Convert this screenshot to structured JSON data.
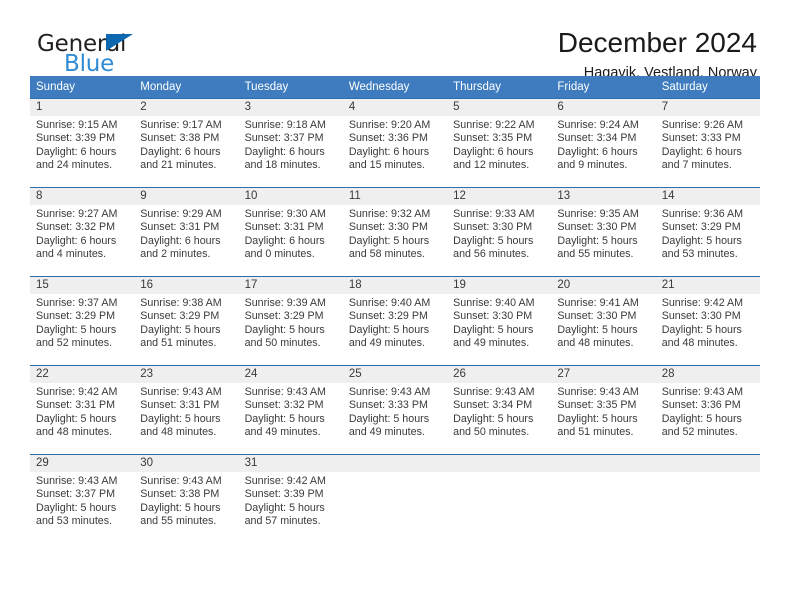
{
  "brand": {
    "name_part1": "General",
    "name_part2": "Blue",
    "triangle_color": "#0d68b1",
    "blue_color": "#2e8bd4"
  },
  "header": {
    "title": "December 2024",
    "subtitle": "Hagavik, Vestland, Norway"
  },
  "theme": {
    "header_blue": "#3e7cbf",
    "row_divider": "#2d6ca8",
    "daynum_band": "#efefef",
    "text": "#3a3a3a"
  },
  "weekdays": [
    "Sunday",
    "Monday",
    "Tuesday",
    "Wednesday",
    "Thursday",
    "Friday",
    "Saturday"
  ],
  "weeks": [
    [
      {
        "day": "1",
        "sunrise": "Sunrise: 9:15 AM",
        "sunset": "Sunset: 3:39 PM",
        "daylight1": "Daylight: 6 hours",
        "daylight2": "and 24 minutes."
      },
      {
        "day": "2",
        "sunrise": "Sunrise: 9:17 AM",
        "sunset": "Sunset: 3:38 PM",
        "daylight1": "Daylight: 6 hours",
        "daylight2": "and 21 minutes."
      },
      {
        "day": "3",
        "sunrise": "Sunrise: 9:18 AM",
        "sunset": "Sunset: 3:37 PM",
        "daylight1": "Daylight: 6 hours",
        "daylight2": "and 18 minutes."
      },
      {
        "day": "4",
        "sunrise": "Sunrise: 9:20 AM",
        "sunset": "Sunset: 3:36 PM",
        "daylight1": "Daylight: 6 hours",
        "daylight2": "and 15 minutes."
      },
      {
        "day": "5",
        "sunrise": "Sunrise: 9:22 AM",
        "sunset": "Sunset: 3:35 PM",
        "daylight1": "Daylight: 6 hours",
        "daylight2": "and 12 minutes."
      },
      {
        "day": "6",
        "sunrise": "Sunrise: 9:24 AM",
        "sunset": "Sunset: 3:34 PM",
        "daylight1": "Daylight: 6 hours",
        "daylight2": "and 9 minutes."
      },
      {
        "day": "7",
        "sunrise": "Sunrise: 9:26 AM",
        "sunset": "Sunset: 3:33 PM",
        "daylight1": "Daylight: 6 hours",
        "daylight2": "and 7 minutes."
      }
    ],
    [
      {
        "day": "8",
        "sunrise": "Sunrise: 9:27 AM",
        "sunset": "Sunset: 3:32 PM",
        "daylight1": "Daylight: 6 hours",
        "daylight2": "and 4 minutes."
      },
      {
        "day": "9",
        "sunrise": "Sunrise: 9:29 AM",
        "sunset": "Sunset: 3:31 PM",
        "daylight1": "Daylight: 6 hours",
        "daylight2": "and 2 minutes."
      },
      {
        "day": "10",
        "sunrise": "Sunrise: 9:30 AM",
        "sunset": "Sunset: 3:31 PM",
        "daylight1": "Daylight: 6 hours",
        "daylight2": "and 0 minutes."
      },
      {
        "day": "11",
        "sunrise": "Sunrise: 9:32 AM",
        "sunset": "Sunset: 3:30 PM",
        "daylight1": "Daylight: 5 hours",
        "daylight2": "and 58 minutes."
      },
      {
        "day": "12",
        "sunrise": "Sunrise: 9:33 AM",
        "sunset": "Sunset: 3:30 PM",
        "daylight1": "Daylight: 5 hours",
        "daylight2": "and 56 minutes."
      },
      {
        "day": "13",
        "sunrise": "Sunrise: 9:35 AM",
        "sunset": "Sunset: 3:30 PM",
        "daylight1": "Daylight: 5 hours",
        "daylight2": "and 55 minutes."
      },
      {
        "day": "14",
        "sunrise": "Sunrise: 9:36 AM",
        "sunset": "Sunset: 3:29 PM",
        "daylight1": "Daylight: 5 hours",
        "daylight2": "and 53 minutes."
      }
    ],
    [
      {
        "day": "15",
        "sunrise": "Sunrise: 9:37 AM",
        "sunset": "Sunset: 3:29 PM",
        "daylight1": "Daylight: 5 hours",
        "daylight2": "and 52 minutes."
      },
      {
        "day": "16",
        "sunrise": "Sunrise: 9:38 AM",
        "sunset": "Sunset: 3:29 PM",
        "daylight1": "Daylight: 5 hours",
        "daylight2": "and 51 minutes."
      },
      {
        "day": "17",
        "sunrise": "Sunrise: 9:39 AM",
        "sunset": "Sunset: 3:29 PM",
        "daylight1": "Daylight: 5 hours",
        "daylight2": "and 50 minutes."
      },
      {
        "day": "18",
        "sunrise": "Sunrise: 9:40 AM",
        "sunset": "Sunset: 3:29 PM",
        "daylight1": "Daylight: 5 hours",
        "daylight2": "and 49 minutes."
      },
      {
        "day": "19",
        "sunrise": "Sunrise: 9:40 AM",
        "sunset": "Sunset: 3:30 PM",
        "daylight1": "Daylight: 5 hours",
        "daylight2": "and 49 minutes."
      },
      {
        "day": "20",
        "sunrise": "Sunrise: 9:41 AM",
        "sunset": "Sunset: 3:30 PM",
        "daylight1": "Daylight: 5 hours",
        "daylight2": "and 48 minutes."
      },
      {
        "day": "21",
        "sunrise": "Sunrise: 9:42 AM",
        "sunset": "Sunset: 3:30 PM",
        "daylight1": "Daylight: 5 hours",
        "daylight2": "and 48 minutes."
      }
    ],
    [
      {
        "day": "22",
        "sunrise": "Sunrise: 9:42 AM",
        "sunset": "Sunset: 3:31 PM",
        "daylight1": "Daylight: 5 hours",
        "daylight2": "and 48 minutes."
      },
      {
        "day": "23",
        "sunrise": "Sunrise: 9:43 AM",
        "sunset": "Sunset: 3:31 PM",
        "daylight1": "Daylight: 5 hours",
        "daylight2": "and 48 minutes."
      },
      {
        "day": "24",
        "sunrise": "Sunrise: 9:43 AM",
        "sunset": "Sunset: 3:32 PM",
        "daylight1": "Daylight: 5 hours",
        "daylight2": "and 49 minutes."
      },
      {
        "day": "25",
        "sunrise": "Sunrise: 9:43 AM",
        "sunset": "Sunset: 3:33 PM",
        "daylight1": "Daylight: 5 hours",
        "daylight2": "and 49 minutes."
      },
      {
        "day": "26",
        "sunrise": "Sunrise: 9:43 AM",
        "sunset": "Sunset: 3:34 PM",
        "daylight1": "Daylight: 5 hours",
        "daylight2": "and 50 minutes."
      },
      {
        "day": "27",
        "sunrise": "Sunrise: 9:43 AM",
        "sunset": "Sunset: 3:35 PM",
        "daylight1": "Daylight: 5 hours",
        "daylight2": "and 51 minutes."
      },
      {
        "day": "28",
        "sunrise": "Sunrise: 9:43 AM",
        "sunset": "Sunset: 3:36 PM",
        "daylight1": "Daylight: 5 hours",
        "daylight2": "and 52 minutes."
      }
    ],
    [
      {
        "day": "29",
        "sunrise": "Sunrise: 9:43 AM",
        "sunset": "Sunset: 3:37 PM",
        "daylight1": "Daylight: 5 hours",
        "daylight2": "and 53 minutes."
      },
      {
        "day": "30",
        "sunrise": "Sunrise: 9:43 AM",
        "sunset": "Sunset: 3:38 PM",
        "daylight1": "Daylight: 5 hours",
        "daylight2": "and 55 minutes."
      },
      {
        "day": "31",
        "sunrise": "Sunrise: 9:42 AM",
        "sunset": "Sunset: 3:39 PM",
        "daylight1": "Daylight: 5 hours",
        "daylight2": "and 57 minutes."
      },
      {
        "day": "",
        "sunrise": "",
        "sunset": "",
        "daylight1": "",
        "daylight2": ""
      },
      {
        "day": "",
        "sunrise": "",
        "sunset": "",
        "daylight1": "",
        "daylight2": ""
      },
      {
        "day": "",
        "sunrise": "",
        "sunset": "",
        "daylight1": "",
        "daylight2": ""
      },
      {
        "day": "",
        "sunrise": "",
        "sunset": "",
        "daylight1": "",
        "daylight2": ""
      }
    ]
  ]
}
